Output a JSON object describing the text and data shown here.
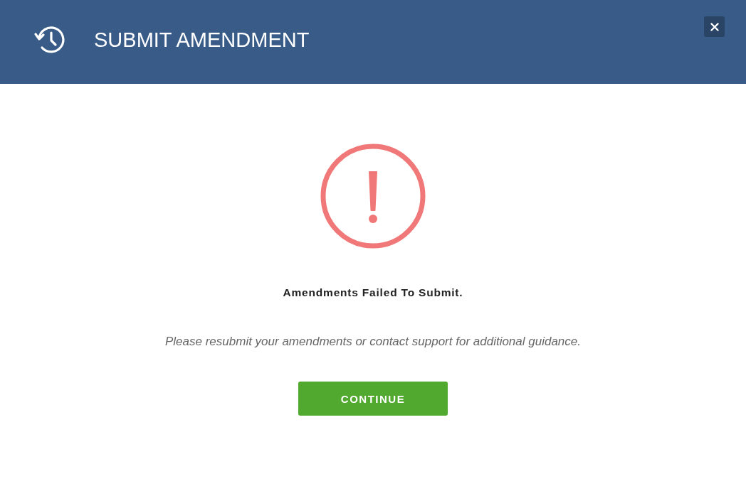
{
  "dialog": {
    "title": "SUBMIT AMENDMENT",
    "heading": "Amendments Failed To Submit.",
    "message": "Please resubmit your amendments or contact support for additional guidance.",
    "button": "CONTINUE"
  }
}
